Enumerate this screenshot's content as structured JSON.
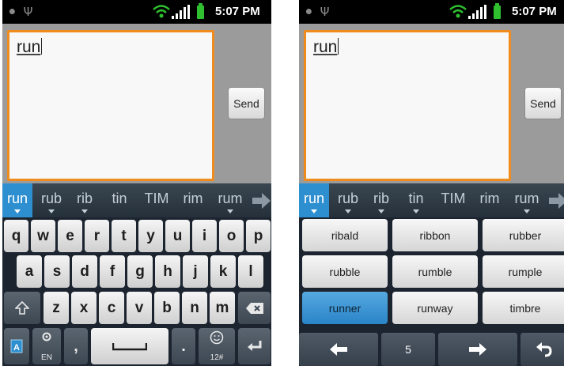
{
  "status_bar": {
    "left_icons": [
      "android-debug-icon",
      "usb-icon"
    ],
    "right_icons": [
      "wifi-icon",
      "signal-icon",
      "battery-icon"
    ],
    "time": "5:07 PM"
  },
  "compose": {
    "message_text": "run",
    "send_label": "Send"
  },
  "suggestions": [
    "run",
    "rub",
    "rib",
    "tin",
    "TIM",
    "rim",
    "rum"
  ],
  "keyboard": {
    "row1": [
      "q",
      "w",
      "e",
      "r",
      "t",
      "y",
      "u",
      "i",
      "o",
      "p"
    ],
    "row2": [
      "a",
      "s",
      "d",
      "f",
      "g",
      "h",
      "j",
      "k",
      "l"
    ],
    "row3": [
      "z",
      "x",
      "c",
      "v",
      "b",
      "n",
      "m"
    ],
    "bottom": {
      "comma": ",",
      "period": ".",
      "lang_sub": "EN",
      "symbols_sub": "12#"
    }
  },
  "word_list": {
    "words": [
      "ribald",
      "ribbon",
      "rubber",
      "rubble",
      "rumble",
      "rumple",
      "runner",
      "runway",
      "timbre"
    ],
    "page_number": "5"
  },
  "colors": {
    "accent": "#f08c1e",
    "selection": "#2e8fd0"
  }
}
